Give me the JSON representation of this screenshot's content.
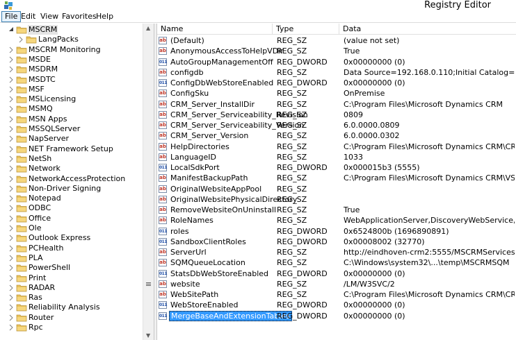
{
  "window": {
    "title": "Registry Editor",
    "app_icon": "regedit-icon"
  },
  "menu": [
    "File",
    "Edit",
    "View",
    "Favorites",
    "Help"
  ],
  "tree": {
    "items": [
      {
        "label": "MSCRM",
        "level": 1,
        "expanded": true,
        "selected": true
      },
      {
        "label": "LangPacks",
        "level": 2,
        "expanded": false
      },
      {
        "label": "MSCRM Monitoring",
        "level": 1,
        "expanded": false
      },
      {
        "label": "MSDE",
        "level": 1,
        "expanded": false
      },
      {
        "label": "MSDRM",
        "level": 1,
        "expanded": false
      },
      {
        "label": "MSDTC",
        "level": 1,
        "expanded": false
      },
      {
        "label": "MSF",
        "level": 1,
        "expanded": false
      },
      {
        "label": "MSLicensing",
        "level": 1,
        "expanded": false
      },
      {
        "label": "MSMQ",
        "level": 1,
        "expanded": false
      },
      {
        "label": "MSN Apps",
        "level": 1,
        "expanded": false
      },
      {
        "label": "MSSQLServer",
        "level": 1,
        "expanded": false
      },
      {
        "label": "NapServer",
        "level": 1,
        "expanded": false
      },
      {
        "label": "NET Framework Setup",
        "level": 1,
        "expanded": false
      },
      {
        "label": "NetSh",
        "level": 1,
        "expanded": false
      },
      {
        "label": "Network",
        "level": 1,
        "expanded": false
      },
      {
        "label": "NetworkAccessProtection",
        "level": 1,
        "expanded": false
      },
      {
        "label": "Non-Driver Signing",
        "level": 1,
        "expanded": false
      },
      {
        "label": "Notepad",
        "level": 1,
        "expanded": false
      },
      {
        "label": "ODBC",
        "level": 1,
        "expanded": false
      },
      {
        "label": "Office",
        "level": 1,
        "expanded": false
      },
      {
        "label": "Ole",
        "level": 1,
        "expanded": false
      },
      {
        "label": "Outlook Express",
        "level": 1,
        "expanded": false
      },
      {
        "label": "PCHealth",
        "level": 1,
        "expanded": false
      },
      {
        "label": "PLA",
        "level": 1,
        "expanded": false
      },
      {
        "label": "PowerShell",
        "level": 1,
        "expanded": false
      },
      {
        "label": "Print",
        "level": 1,
        "expanded": false
      },
      {
        "label": "RADAR",
        "level": 1,
        "expanded": false
      },
      {
        "label": "Ras",
        "level": 1,
        "expanded": false
      },
      {
        "label": "Reliability Analysis",
        "level": 1,
        "expanded": false
      },
      {
        "label": "Router",
        "level": 1,
        "expanded": false
      },
      {
        "label": "Rpc",
        "level": 1,
        "expanded": false
      }
    ]
  },
  "columns": [
    "Name",
    "Type",
    "Data"
  ],
  "values": [
    {
      "name": "(Default)",
      "type": "REG_SZ",
      "data": "(value not set)",
      "icon": "ab"
    },
    {
      "name": "AnonymousAccessToHelpVDir",
      "type": "REG_SZ",
      "data": "True",
      "icon": "ab"
    },
    {
      "name": "AutoGroupManagementOff",
      "type": "REG_DWORD",
      "data": "0x00000000 (0)",
      "icon": "bin"
    },
    {
      "name": "configdb",
      "type": "REG_SZ",
      "data": "Data Source=192.168.0.110;Initial Catalog=MSCRM...",
      "icon": "ab"
    },
    {
      "name": "ConfigDbWebStoreEnabled",
      "type": "REG_DWORD",
      "data": "0x00000000 (0)",
      "icon": "bin"
    },
    {
      "name": "ConfigSku",
      "type": "REG_SZ",
      "data": "OnPremise",
      "icon": "ab"
    },
    {
      "name": "CRM_Server_InstallDir",
      "type": "REG_SZ",
      "data": "C:\\Program Files\\Microsoft Dynamics CRM",
      "icon": "ab"
    },
    {
      "name": "CRM_Server_Serviceability_Revision",
      "type": "REG_SZ",
      "data": "0809",
      "icon": "ab"
    },
    {
      "name": "CRM_Server_Serviceability_Version",
      "type": "REG_SZ",
      "data": "6.0.0000.0809",
      "icon": "ab"
    },
    {
      "name": "CRM_Server_Version",
      "type": "REG_SZ",
      "data": "6.0.0000.0302",
      "icon": "ab"
    },
    {
      "name": "HelpDirectories",
      "type": "REG_SZ",
      "data": "C:\\Program Files\\Microsoft Dynamics CRM\\CRM...",
      "icon": "ab"
    },
    {
      "name": "LanguageID",
      "type": "REG_SZ",
      "data": "1033",
      "icon": "ab"
    },
    {
      "name": "LocalSdkPort",
      "type": "REG_DWORD",
      "data": "0x000015b3 (5555)",
      "icon": "bin"
    },
    {
      "name": "ManifestBackupPath",
      "type": "REG_SZ",
      "data": "C:\\Program Files\\Microsoft Dynamics CRM\\VSS",
      "icon": "ab"
    },
    {
      "name": "OriginalWebsiteAppPool",
      "type": "REG_SZ",
      "data": "",
      "icon": "ab"
    },
    {
      "name": "OriginalWebsitePhysicalDirectory",
      "type": "REG_SZ",
      "data": "",
      "icon": "ab"
    },
    {
      "name": "RemoveWebsiteOnUninstall",
      "type": "REG_SZ",
      "data": "True",
      "icon": "ab"
    },
    {
      "name": "RoleNames",
      "type": "REG_SZ",
      "data": "WebApplicationServer,DiscoveryWebService,Deplo...",
      "icon": "ab"
    },
    {
      "name": "roles",
      "type": "REG_DWORD",
      "data": "0x6524800b (1696890891)",
      "icon": "bin"
    },
    {
      "name": "SandboxClientRoles",
      "type": "REG_DWORD",
      "data": "0x00008002 (32770)",
      "icon": "bin"
    },
    {
      "name": "ServerUrl",
      "type": "REG_SZ",
      "data": "http://eindhoven-crm2:5555/MSCRMServices",
      "icon": "ab"
    },
    {
      "name": "SQMQueueLocation",
      "type": "REG_SZ",
      "data": "C:\\Windows\\system32\\...\\temp\\MSCRMSQM",
      "icon": "ab"
    },
    {
      "name": "StatsDbWebStoreEnabled",
      "type": "REG_DWORD",
      "data": "0x00000000 (0)",
      "icon": "bin"
    },
    {
      "name": "website",
      "type": "REG_SZ",
      "data": "/LM/W3SVC/2",
      "icon": "ab"
    },
    {
      "name": "WebSitePath",
      "type": "REG_SZ",
      "data": "C:\\Program Files\\Microsoft Dynamics CRM\\CRM...",
      "icon": "ab"
    },
    {
      "name": "WebStoreEnabled",
      "type": "REG_DWORD",
      "data": "0x00000000 (0)",
      "icon": "bin"
    },
    {
      "name": "MergeBaseAndExtensionTables",
      "type": "REG_DWORD",
      "data": "0x00000000 (0)",
      "icon": "bin",
      "selected": true
    }
  ],
  "colors": {
    "selection": "#3399ff",
    "folder": "#e8c15a",
    "menu_active": "#e5f1fb"
  }
}
